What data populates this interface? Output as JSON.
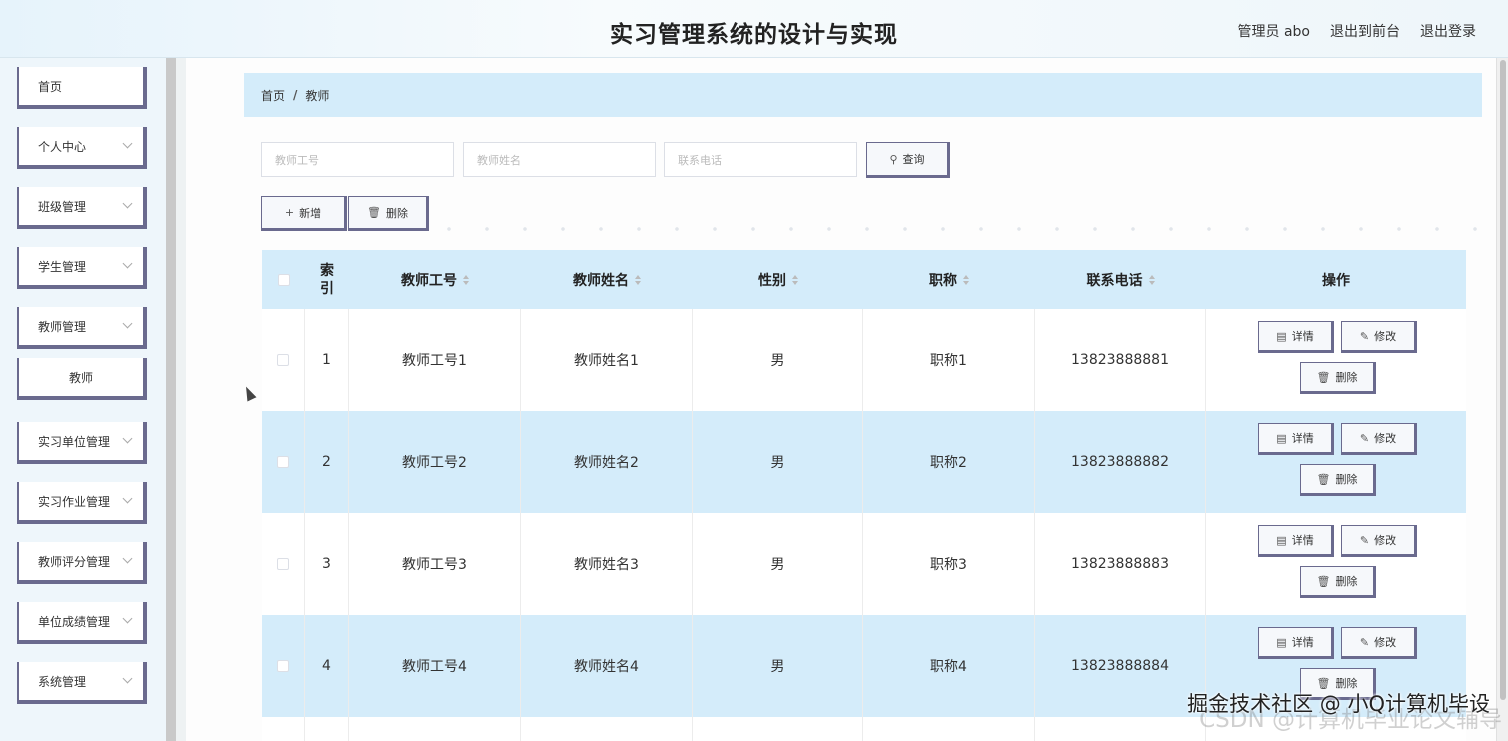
{
  "header": {
    "title": "实习管理系统的设计与实现",
    "user": "管理员 abo",
    "back_front": "退出到前台",
    "logout": "退出登录"
  },
  "sidebar": {
    "items": [
      {
        "label": "首页"
      },
      {
        "label": "个人中心"
      },
      {
        "label": "班级管理"
      },
      {
        "label": "学生管理"
      },
      {
        "label": "教师管理"
      },
      {
        "label": "教师"
      },
      {
        "label": "实习单位管理"
      },
      {
        "label": "实习作业管理"
      },
      {
        "label": "教师评分管理"
      },
      {
        "label": "单位成绩管理"
      },
      {
        "label": "系统管理"
      }
    ]
  },
  "breadcrumb": {
    "home": "首页",
    "sep": "/",
    "current": "教师"
  },
  "search": {
    "teacher_no_placeholder": "教师工号",
    "teacher_name_placeholder": "教师姓名",
    "phone_placeholder": "联系电话",
    "query_label": "查询"
  },
  "toolbar": {
    "add_label": "新增",
    "delete_label": "删除"
  },
  "table": {
    "headers": {
      "index": "索引",
      "teacher_no": "教师工号",
      "teacher_name": "教师姓名",
      "sex": "性别",
      "title": "职称",
      "phone": "联系电话",
      "ops": "操作"
    },
    "rows": [
      {
        "index": "1",
        "teacher_no": "教师工号1",
        "teacher_name": "教师姓名1",
        "sex": "男",
        "title": "职称1",
        "phone": "13823888881"
      },
      {
        "index": "2",
        "teacher_no": "教师工号2",
        "teacher_name": "教师姓名2",
        "sex": "男",
        "title": "职称2",
        "phone": "13823888882"
      },
      {
        "index": "3",
        "teacher_no": "教师工号3",
        "teacher_name": "教师姓名3",
        "sex": "男",
        "title": "职称3",
        "phone": "13823888883"
      },
      {
        "index": "4",
        "teacher_no": "教师工号4",
        "teacher_name": "教师姓名4",
        "sex": "男",
        "title": "职称4",
        "phone": "13823888884"
      }
    ],
    "op_labels": {
      "detail": "详情",
      "edit": "修改",
      "delete": "删除"
    }
  },
  "watermark": "掘金技术社区 @ 小Q计算机毕设",
  "watermark_faint": "CSDN @计算机毕业论文辅导",
  "colors": {
    "accent_blue": "#d4ecfa",
    "button_border": "#6a6a8e"
  }
}
